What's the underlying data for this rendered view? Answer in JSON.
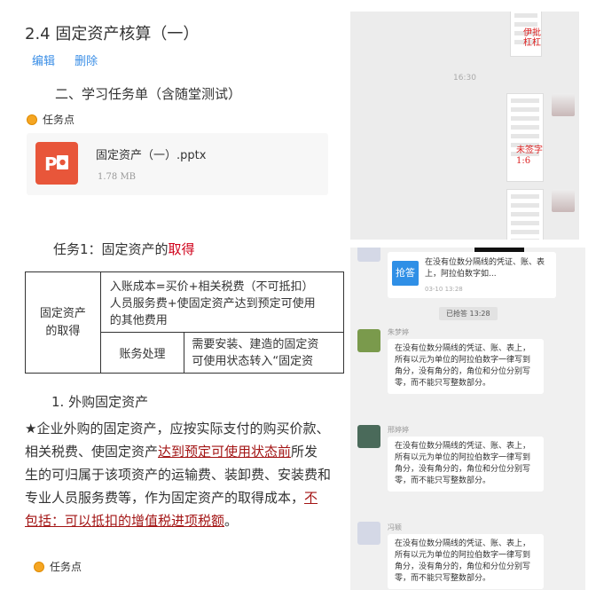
{
  "left": {
    "title": "2.4 固定资产核算（一）",
    "edit": "编辑",
    "delete": "删除",
    "section_title": "二、学习任务单（含随堂测试）",
    "task_point_label": "任务点",
    "file": {
      "name": "固定资产（一）.pptx",
      "size": "1.78 MB"
    },
    "task1_prefix": "任务1：固定资产的",
    "task1_highlight": "取得",
    "table": {
      "left_header": "固定资产的取得",
      "row1_line1": "入账成本=买价+相关税费（不可抵扣）",
      "row1_line2": "人员服务费+使固定资产达到预定可使用",
      "row1_line3": "的其他费用",
      "row2_label": "账务处理",
      "row2_line1": "需要安装、建造的固定资",
      "row2_line2": "可使用状态转入“固定资"
    },
    "heading1": "1. 外购固定资产",
    "para_part1": "★企业外购的固定资产，应按实际支付的购买价款、相关税费、使固定资产",
    "para_ul1": "达到预定可使用状态前",
    "para_part2": "所发生的可归属于该项资产的运输费、装卸费、安装费和专业人员服务费等，作为固定资产的取得成本，",
    "para_ul2": "不包括：可以抵扣的增值税进项税额",
    "para_end": "。",
    "task_point_label2": "任务点"
  },
  "right_top": {
    "time": "16:30",
    "scrib1": "伊批\n杠杠",
    "scrib2": "未签字\n1:6"
  },
  "right_bottom": {
    "card_text": "在没有位数分隔线的凭证、账、表上，阿拉伯数字如...",
    "card_button": "抢答",
    "card_time": "03-10 13:28",
    "time_pill": "已抢答 13:28",
    "messages": [
      {
        "sender": "朱梦婷",
        "text": "在没有位数分隔线的凭证、账、表上，所有以元为单位的阿拉伯数字一律写到角分，没有角分的，角位和分位分别写零，而不能只写整数部分。"
      },
      {
        "sender": "邢婷婷",
        "text": "在没有位数分隔线的凭证、账、表上，所有以元为单位的阿拉伯数字一律写到角分，没有角分的，角位和分位分别写零，而不能只写整数部分。"
      },
      {
        "sender": "冯颖",
        "text": "在没有位数分隔线的凭证、账、表上，所有以元为单位的阿拉伯数字一律写到角分，没有角分的，角位和分位分别写零，而不能只写整数部分。"
      }
    ]
  }
}
